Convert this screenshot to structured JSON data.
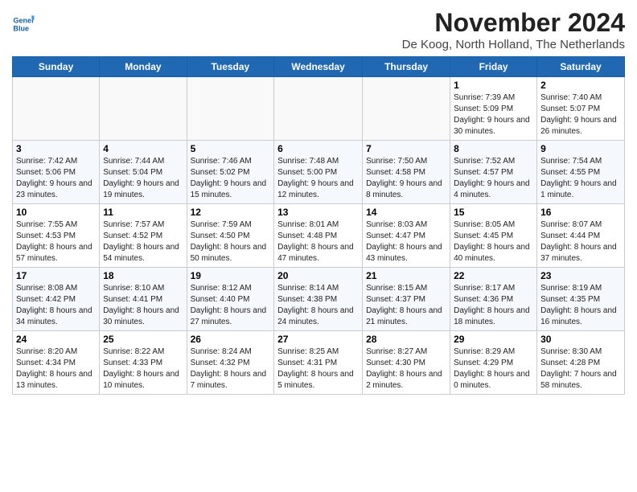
{
  "header": {
    "logo_line1": "General",
    "logo_line2": "Blue",
    "month_title": "November 2024",
    "location": "De Koog, North Holland, The Netherlands"
  },
  "weekdays": [
    "Sunday",
    "Monday",
    "Tuesday",
    "Wednesday",
    "Thursday",
    "Friday",
    "Saturday"
  ],
  "weeks": [
    [
      {
        "day": "",
        "info": ""
      },
      {
        "day": "",
        "info": ""
      },
      {
        "day": "",
        "info": ""
      },
      {
        "day": "",
        "info": ""
      },
      {
        "day": "",
        "info": ""
      },
      {
        "day": "1",
        "info": "Sunrise: 7:39 AM\nSunset: 5:09 PM\nDaylight: 9 hours and 30 minutes."
      },
      {
        "day": "2",
        "info": "Sunrise: 7:40 AM\nSunset: 5:07 PM\nDaylight: 9 hours and 26 minutes."
      }
    ],
    [
      {
        "day": "3",
        "info": "Sunrise: 7:42 AM\nSunset: 5:06 PM\nDaylight: 9 hours and 23 minutes."
      },
      {
        "day": "4",
        "info": "Sunrise: 7:44 AM\nSunset: 5:04 PM\nDaylight: 9 hours and 19 minutes."
      },
      {
        "day": "5",
        "info": "Sunrise: 7:46 AM\nSunset: 5:02 PM\nDaylight: 9 hours and 15 minutes."
      },
      {
        "day": "6",
        "info": "Sunrise: 7:48 AM\nSunset: 5:00 PM\nDaylight: 9 hours and 12 minutes."
      },
      {
        "day": "7",
        "info": "Sunrise: 7:50 AM\nSunset: 4:58 PM\nDaylight: 9 hours and 8 minutes."
      },
      {
        "day": "8",
        "info": "Sunrise: 7:52 AM\nSunset: 4:57 PM\nDaylight: 9 hours and 4 minutes."
      },
      {
        "day": "9",
        "info": "Sunrise: 7:54 AM\nSunset: 4:55 PM\nDaylight: 9 hours and 1 minute."
      }
    ],
    [
      {
        "day": "10",
        "info": "Sunrise: 7:55 AM\nSunset: 4:53 PM\nDaylight: 8 hours and 57 minutes."
      },
      {
        "day": "11",
        "info": "Sunrise: 7:57 AM\nSunset: 4:52 PM\nDaylight: 8 hours and 54 minutes."
      },
      {
        "day": "12",
        "info": "Sunrise: 7:59 AM\nSunset: 4:50 PM\nDaylight: 8 hours and 50 minutes."
      },
      {
        "day": "13",
        "info": "Sunrise: 8:01 AM\nSunset: 4:48 PM\nDaylight: 8 hours and 47 minutes."
      },
      {
        "day": "14",
        "info": "Sunrise: 8:03 AM\nSunset: 4:47 PM\nDaylight: 8 hours and 43 minutes."
      },
      {
        "day": "15",
        "info": "Sunrise: 8:05 AM\nSunset: 4:45 PM\nDaylight: 8 hours and 40 minutes."
      },
      {
        "day": "16",
        "info": "Sunrise: 8:07 AM\nSunset: 4:44 PM\nDaylight: 8 hours and 37 minutes."
      }
    ],
    [
      {
        "day": "17",
        "info": "Sunrise: 8:08 AM\nSunset: 4:42 PM\nDaylight: 8 hours and 34 minutes."
      },
      {
        "day": "18",
        "info": "Sunrise: 8:10 AM\nSunset: 4:41 PM\nDaylight: 8 hours and 30 minutes."
      },
      {
        "day": "19",
        "info": "Sunrise: 8:12 AM\nSunset: 4:40 PM\nDaylight: 8 hours and 27 minutes."
      },
      {
        "day": "20",
        "info": "Sunrise: 8:14 AM\nSunset: 4:38 PM\nDaylight: 8 hours and 24 minutes."
      },
      {
        "day": "21",
        "info": "Sunrise: 8:15 AM\nSunset: 4:37 PM\nDaylight: 8 hours and 21 minutes."
      },
      {
        "day": "22",
        "info": "Sunrise: 8:17 AM\nSunset: 4:36 PM\nDaylight: 8 hours and 18 minutes."
      },
      {
        "day": "23",
        "info": "Sunrise: 8:19 AM\nSunset: 4:35 PM\nDaylight: 8 hours and 16 minutes."
      }
    ],
    [
      {
        "day": "24",
        "info": "Sunrise: 8:20 AM\nSunset: 4:34 PM\nDaylight: 8 hours and 13 minutes."
      },
      {
        "day": "25",
        "info": "Sunrise: 8:22 AM\nSunset: 4:33 PM\nDaylight: 8 hours and 10 minutes."
      },
      {
        "day": "26",
        "info": "Sunrise: 8:24 AM\nSunset: 4:32 PM\nDaylight: 8 hours and 7 minutes."
      },
      {
        "day": "27",
        "info": "Sunrise: 8:25 AM\nSunset: 4:31 PM\nDaylight: 8 hours and 5 minutes."
      },
      {
        "day": "28",
        "info": "Sunrise: 8:27 AM\nSunset: 4:30 PM\nDaylight: 8 hours and 2 minutes."
      },
      {
        "day": "29",
        "info": "Sunrise: 8:29 AM\nSunset: 4:29 PM\nDaylight: 8 hours and 0 minutes."
      },
      {
        "day": "30",
        "info": "Sunrise: 8:30 AM\nSunset: 4:28 PM\nDaylight: 7 hours and 58 minutes."
      }
    ]
  ]
}
